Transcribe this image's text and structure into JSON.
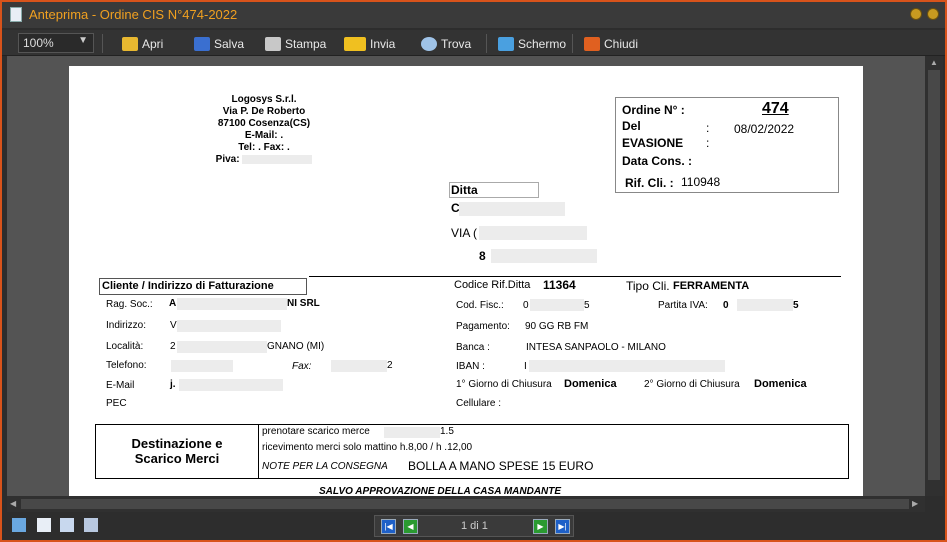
{
  "window": {
    "title": "Anteprima - Ordine CIS N°474-2022"
  },
  "toolbar": {
    "zoom": "100%",
    "apri": "Apri",
    "salva": "Salva",
    "stampa": "Stampa",
    "invia": "Invia",
    "trova": "Trova",
    "schermo": "Schermo",
    "chiudi": "Chiudi"
  },
  "company": {
    "name": "Logosys S.r.l.",
    "street": "Via P. De Roberto",
    "city": "87100 Cosenza(CS)",
    "email": "E-Mail: .",
    "tel": "Tel: . Fax: .",
    "piva": "Piva: "
  },
  "order": {
    "num_label": "Ordine N° :",
    "num": "474",
    "del_label": "Del",
    "colon": ":",
    "date": "08/02/2022",
    "evasione_label": "EVASIONE",
    "cons_label": "Data Cons. :",
    "rif_label": "Rif. Cli. :",
    "rif": "110948"
  },
  "ditta": {
    "label": "Ditta",
    "line1": "C",
    "line2": "VIA (",
    "line3": "8"
  },
  "section_cliente": "Cliente / Indirizzo di Fatturazione",
  "right_header": {
    "codice_label": "Codice Rif.Ditta",
    "codice": "11364",
    "tipo_label": "Tipo Cli.",
    "tipo": "FERRAMENTA"
  },
  "cliente": {
    "ragsoc_label": "Rag. Soc.:",
    "ragsoc_a": "A",
    "ragsoc_b": "NI SRL",
    "indirizzo_label": "Indirizzo:",
    "indirizzo": "V",
    "localita_label": "Località:",
    "localita_a": "2",
    "localita_b": "GNANO  (MI)",
    "telefono_label": "Telefono:",
    "fax_label": "Fax:",
    "fax_tail": "2",
    "email_label": "E-Mail",
    "email": "j.",
    "pec_label": "PEC"
  },
  "right": {
    "codfisc_label": "Cod. Fisc.:",
    "codfisc_a": "0",
    "codfisc_b": "5",
    "piva_label": "Partita IVA:",
    "piva_a": "0",
    "piva_b": "5",
    "pagamento_label": "Pagamento:",
    "pagamento": "90 GG RB FM",
    "banca_label": "Banca :",
    "banca": "INTESA SANPAOLO - MILANO",
    "iban_label": "IBAN :",
    "iban": "I",
    "giorno1_label": "1° Giorno di Chiusura",
    "giorno1": "Domenica",
    "giorno2_label": "2° Giorno di Chiusura",
    "giorno2": "Domenica",
    "cellulare_label": "Cellulare :"
  },
  "destinazione": {
    "title1": "Destinazione e",
    "title2": "Scarico Merci",
    "line1_a": "prenotare scarico merce ",
    "line1_b": "1.5",
    "line2": "ricevimento merci solo mattino  h.8,00 / h .12,00",
    "note_label": "NOTE PER LA CONSEGNA",
    "note": "BOLLA A MANO SPESE 15 EURO"
  },
  "footer_note": "SALVO APPROVAZIONE DELLA CASA MANDANTE",
  "pager": {
    "text": "1 di 1"
  }
}
